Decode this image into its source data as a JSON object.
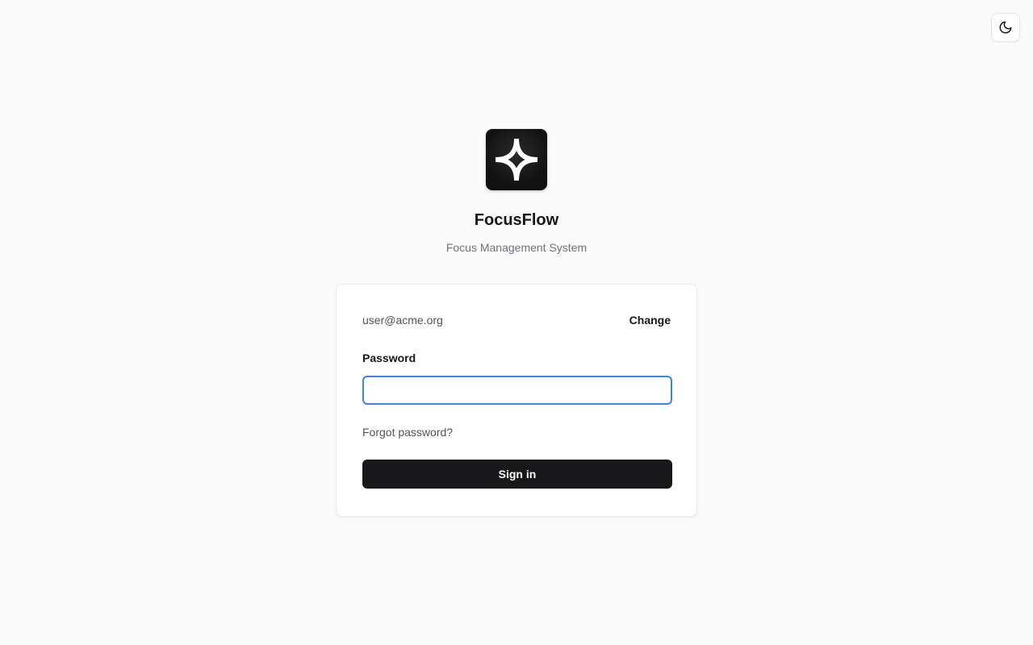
{
  "theme_toggle": {
    "icon": "moon-icon"
  },
  "brand": {
    "logo_icon": "sparkle-icon",
    "app_name": "FocusFlow",
    "tagline": "Focus Management System"
  },
  "login": {
    "email": "user@acme.org",
    "change_label": "Change",
    "password_label": "Password",
    "password_value": "",
    "password_placeholder": "",
    "forgot_label": "Forgot password?",
    "signin_label": "Sign in"
  },
  "colors": {
    "background": "#fafafa",
    "primary": "#18181b",
    "focus_ring": "#3b82f6",
    "muted_text": "#71717a"
  }
}
